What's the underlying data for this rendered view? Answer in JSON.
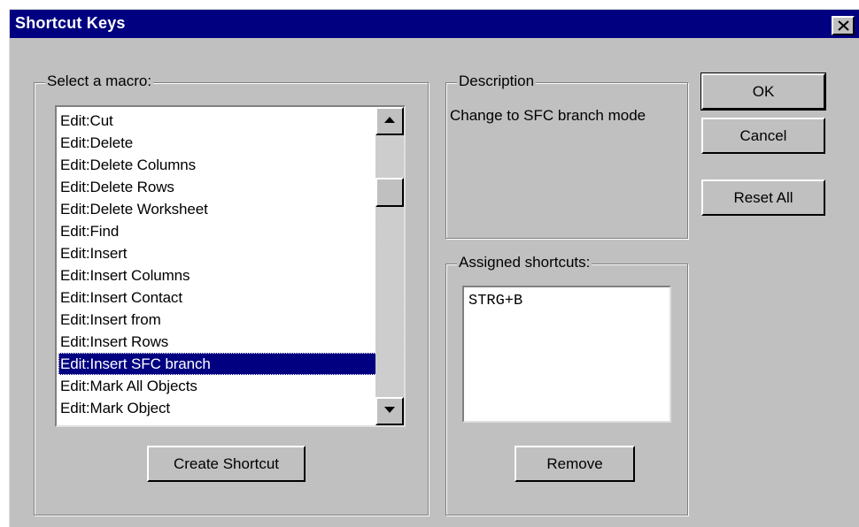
{
  "window": {
    "title": "Shortcut Keys"
  },
  "macro_group": {
    "label": "Select a macro:",
    "items": [
      "Edit:Cut",
      "Edit:Delete",
      "Edit:Delete Columns",
      "Edit:Delete Rows",
      "Edit:Delete Worksheet",
      "Edit:Find",
      "Edit:Insert",
      "Edit:Insert Columns",
      "Edit:Insert Contact",
      "Edit:Insert from",
      "Edit:Insert Rows",
      "Edit:Insert SFC branch",
      "Edit:Mark All Objects",
      "Edit:Mark Object"
    ],
    "selected": "Edit:Insert SFC branch",
    "create_button": "Create Shortcut"
  },
  "description": {
    "label": "Description",
    "text": "Change to SFC branch mode"
  },
  "shortcuts": {
    "label": "Assigned shortcuts:",
    "items": [
      "STRG+B"
    ],
    "remove_button": "Remove"
  },
  "buttons": {
    "ok": "OK",
    "cancel": "Cancel",
    "reset_all": "Reset All"
  },
  "colors": {
    "face": "#c0c0c0",
    "titlebar": "#000080",
    "selection": "#000080"
  },
  "icons": {
    "close": "close-icon",
    "scroll_up": "arrow-up-icon",
    "scroll_down": "arrow-down-icon"
  }
}
